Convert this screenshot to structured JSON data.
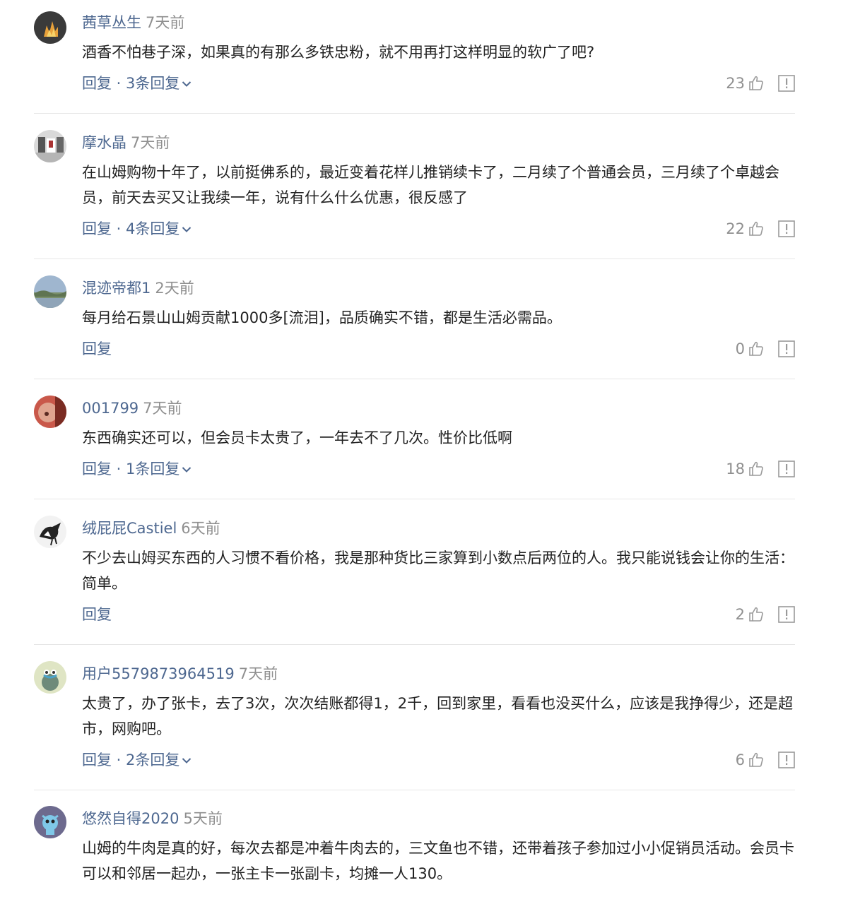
{
  "colors": {
    "username": "#4e6890",
    "time": "#8f8f8f",
    "text": "#222222",
    "divider": "#e6e6e6"
  },
  "icons": {
    "like": "thumbs-up-icon",
    "report": "report-icon",
    "expand": "chevron-down-icon"
  },
  "comments": [
    {
      "user": "茜草丛生",
      "time": "7天前",
      "text": "酒香不怕巷子深，如果真的有那么多铁忠粉，就不用再打这样明显的软广了吧?",
      "reply": "回复",
      "reply_count": "3条回复",
      "likes": "23"
    },
    {
      "user": "摩水晶",
      "time": "7天前",
      "text": "在山姆购物十年了，以前挺佛系的，最近变着花样儿推销续卡了，二月续了个普通会员，三月续了个卓越会员，前天去买又让我续一年，说有什么什么优惠，很反感了",
      "reply": "回复",
      "reply_count": "4条回复",
      "likes": "22"
    },
    {
      "user": "混迹帝都1",
      "time": "2天前",
      "text": "每月给石景山山姆贡献1000多[流泪]，品质确实不错，都是生活必需品。",
      "reply": "回复",
      "reply_count": "",
      "likes": "0"
    },
    {
      "user": "001799",
      "time": "7天前",
      "text": "东西确实还可以，但会员卡太贵了，一年去不了几次。性价比低啊",
      "reply": "回复",
      "reply_count": "1条回复",
      "likes": "18"
    },
    {
      "user": "绒屁屁Castiel",
      "time": "6天前",
      "text": "不少去山姆买东西的人习惯不看价格，我是那种货比三家算到小数点后两位的人。我只能说钱会让你的生活：简单。",
      "reply": "回复",
      "reply_count": "",
      "likes": "2"
    },
    {
      "user": "用户5579873964519",
      "time": "7天前",
      "text": "太贵了，办了张卡，去了3次，次次结账都得1，2千，回到家里，看看也没买什么，应该是我挣得少，还是超市，网购吧。",
      "reply": "回复",
      "reply_count": "2条回复",
      "likes": "6"
    },
    {
      "user": "悠然自得2020",
      "time": "5天前",
      "text": "山姆的牛肉是真的好，每次去都是冲着牛肉去的，三文鱼也不错，还带着孩子参加过小小促销员活动。会员卡可以和邻居一起办，一张主卡一张副卡，均摊一人130。",
      "reply": "",
      "reply_count": "",
      "likes": ""
    }
  ]
}
